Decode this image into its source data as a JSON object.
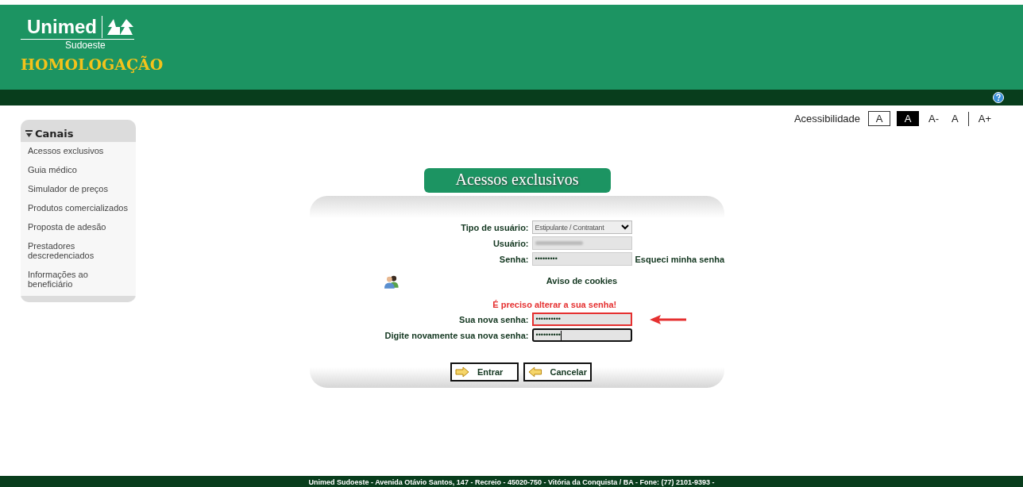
{
  "header": {
    "logo_name": "Unimed",
    "logo_sub": "Sudoeste",
    "environment": "HOMOLOGAÇÃO"
  },
  "accessibility": {
    "label": "Acessibilidade",
    "options": [
      {
        "label": "A",
        "kind": "outlined"
      },
      {
        "label": "A",
        "kind": "filled"
      },
      {
        "label": "A-",
        "kind": "plain"
      },
      {
        "label": "A",
        "kind": "plain"
      },
      {
        "label": "A+",
        "kind": "plain"
      }
    ]
  },
  "sidebar": {
    "title": "Canais",
    "items": [
      "Acessos exclusivos",
      "Guia médico",
      "Simulador de preços",
      "Produtos comercializados",
      "Proposta de adesão",
      "Prestadores descredenciados",
      "Informações ao beneficiário"
    ]
  },
  "form": {
    "title": "Acessos exclusivos",
    "user_type": {
      "label": "Tipo de usuário:",
      "value": "Estipulante / Contratant"
    },
    "user": {
      "label": "Usuário:"
    },
    "password": {
      "label": "Senha:",
      "value": "•••••••••",
      "link": "Esqueci minha senha"
    },
    "cookies_link": "Aviso de cookies",
    "warning": "É preciso alterar a sua senha!",
    "new_password": {
      "label": "Sua nova senha:",
      "value": "••••••••••",
      "highlighted": true
    },
    "confirm_password": {
      "label": "Digite novamente sua nova senha:",
      "value": "••••••••••",
      "focused": true
    },
    "buttons": [
      {
        "label": "Entrar",
        "kind": "forward"
      },
      {
        "label": "Cancelar",
        "kind": "back"
      }
    ]
  },
  "footer": "Unimed Sudoeste - Avenida Otávio Santos, 147 - Recreio - 45020-750 - Vitória da Conquista / BA - Fone: (77) 2101-9393 -"
}
